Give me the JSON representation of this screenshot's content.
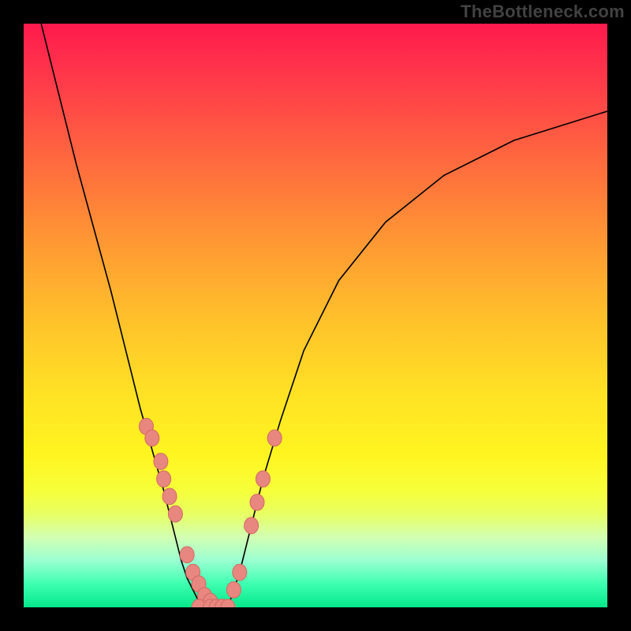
{
  "watermark": "TheBottleneck.com",
  "chart_data": {
    "type": "line",
    "title": "",
    "xlabel": "",
    "ylabel": "",
    "xlim": [
      0,
      100
    ],
    "ylim": [
      0,
      100
    ],
    "grid": false,
    "legend": false,
    "series": [
      {
        "name": "left-curve",
        "x": [
          3,
          6,
          9,
          12,
          15,
          18,
          20,
          22,
          24,
          26,
          27,
          28,
          29,
          30,
          31
        ],
        "y": [
          100,
          88,
          76,
          65,
          54,
          42,
          34,
          27,
          20,
          12,
          8,
          5,
          3,
          1,
          0
        ]
      },
      {
        "name": "right-curve",
        "x": [
          35,
          37,
          39,
          41,
          44,
          48,
          54,
          62,
          72,
          84,
          100
        ],
        "y": [
          0,
          6,
          14,
          22,
          32,
          44,
          56,
          66,
          74,
          80,
          85
        ]
      }
    ],
    "left_markers": {
      "name": "left-branch-dots",
      "x": [
        21,
        22,
        23.5,
        24,
        25,
        26,
        28,
        29,
        30,
        31,
        32,
        34
      ],
      "y": [
        31,
        29,
        25,
        22,
        19,
        16,
        9,
        6,
        4,
        2,
        1,
        0
      ]
    },
    "right_markers": {
      "name": "right-branch-dots",
      "x": [
        36,
        37,
        39,
        40,
        41,
        43
      ],
      "y": [
        3,
        6,
        14,
        18,
        22,
        29
      ]
    },
    "bottom_markers": {
      "name": "bottom-dots",
      "x": [
        30,
        32,
        33,
        34,
        35
      ],
      "y": [
        0,
        0,
        0,
        0,
        0
      ]
    },
    "marker_style": {
      "fill": "#e8877f",
      "stroke": "#d16a63",
      "r": 9
    }
  }
}
